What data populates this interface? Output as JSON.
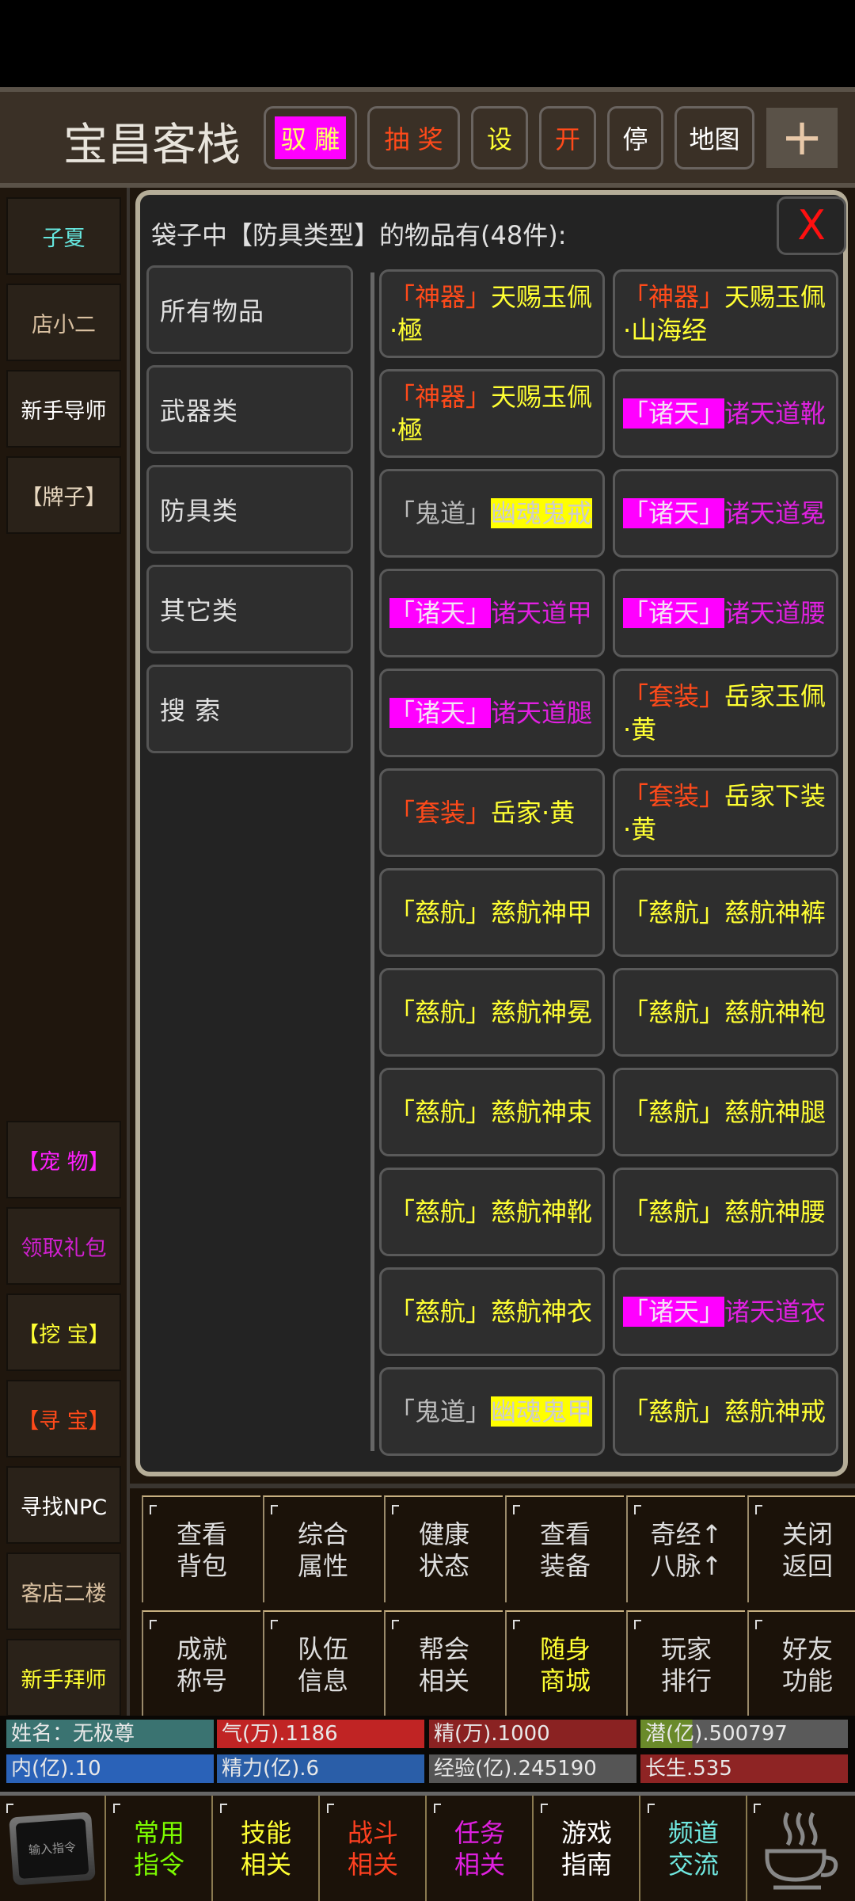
{
  "header": {
    "title": "宝昌客栈",
    "buttons": [
      {
        "label": "驭 雕",
        "color": "#ffff66",
        "bg": "#ff00ff"
      },
      {
        "label": "抽 奖",
        "color": "#ff4a1a"
      },
      {
        "label": "设",
        "color": "#ffff33"
      },
      {
        "label": "开",
        "color": "#ff4a1a"
      },
      {
        "label": "停",
        "color": "#ffffff"
      },
      {
        "label": "地图",
        "color": "#ffffff"
      }
    ],
    "plus_label": "+"
  },
  "sidebar": {
    "top": [
      {
        "label": "子夏",
        "color": "#66e8e0"
      },
      {
        "label": "店小二",
        "color": "#d9c0a0"
      },
      {
        "label": "新手导师",
        "color": "#ffffff"
      },
      {
        "label": "【牌子】",
        "color": "#e8d8c0"
      }
    ],
    "bottom": [
      {
        "label": "【宠 物】",
        "color": "#ff20ff"
      },
      {
        "label": "领取礼包",
        "color": "#d020d0"
      },
      {
        "label": "【挖 宝】",
        "color": "#ffff33"
      },
      {
        "label": "【寻 宝】",
        "color": "#ff4a1a"
      },
      {
        "label": "寻找NPC",
        "color": "#ffffff"
      },
      {
        "label": "客店二楼",
        "color": "#d9c0a0"
      },
      {
        "label": "新手拜师",
        "color": "#ffff33"
      }
    ]
  },
  "dialog": {
    "title": "袋子中【防具类型】的物品有(48件):",
    "close_label": "X",
    "categories": [
      "所有物品",
      "武器类",
      "防具类",
      "其它类",
      "搜  索"
    ],
    "items": [
      {
        "prefix": "「神器」",
        "name": "天赐玉佩·極",
        "style": "shenqi"
      },
      {
        "prefix": "「神器」",
        "name": "天赐玉佩·山海经",
        "style": "shenqi"
      },
      {
        "prefix": "「神器」",
        "name": "天赐玉佩·極",
        "style": "shenqi"
      },
      {
        "prefix": "「诸天」",
        "name": "诸天道靴",
        "style": "zhutian"
      },
      {
        "prefix": "「鬼道」",
        "name": "幽魂鬼戒",
        "style": "guidao"
      },
      {
        "prefix": "「诸天」",
        "name": "诸天道冕",
        "style": "zhutian"
      },
      {
        "prefix": "「诸天」",
        "name": "诸天道甲",
        "style": "zhutian"
      },
      {
        "prefix": "「诸天」",
        "name": "诸天道腰",
        "style": "zhutian"
      },
      {
        "prefix": "「诸天」",
        "name": "诸天道腿",
        "style": "zhutian"
      },
      {
        "prefix": "「套装」",
        "name": "岳家玉佩·黄",
        "style": "taozhuang"
      },
      {
        "prefix": "「套装」",
        "name": "岳家·黄",
        "style": "taozhuang"
      },
      {
        "prefix": "「套装」",
        "name": "岳家下装·黄",
        "style": "taozhuang"
      },
      {
        "prefix": "「慈航」",
        "name": "慈航神甲",
        "style": "cihang"
      },
      {
        "prefix": "「慈航」",
        "name": "慈航神裤",
        "style": "cihang"
      },
      {
        "prefix": "「慈航」",
        "name": "慈航神冕",
        "style": "cihang"
      },
      {
        "prefix": "「慈航」",
        "name": "慈航神袍",
        "style": "cihang"
      },
      {
        "prefix": "「慈航」",
        "name": "慈航神束",
        "style": "cihang"
      },
      {
        "prefix": "「慈航」",
        "name": "慈航神腿",
        "style": "cihang"
      },
      {
        "prefix": "「慈航」",
        "name": "慈航神靴",
        "style": "cihang"
      },
      {
        "prefix": "「慈航」",
        "name": "慈航神腰",
        "style": "cihang"
      },
      {
        "prefix": "「慈航」",
        "name": "慈航神衣",
        "style": "cihang"
      },
      {
        "prefix": "「诸天」",
        "name": "诸天道衣",
        "style": "zhutian"
      },
      {
        "prefix": "「鬼道」",
        "name": "幽魂鬼甲",
        "style": "guidao"
      },
      {
        "prefix": "「慈航」",
        "name": "慈航神戒",
        "style": "cihang"
      }
    ]
  },
  "styles": {
    "shenqi": {
      "pc": "#ff4a1a",
      "nc": "#ffff33"
    },
    "zhutian": {
      "pc": "#f4e0f4",
      "pbg": "#ff00ff",
      "nc": "#e020e0"
    },
    "guidao": {
      "pc": "#bbbbbb",
      "nc": "#cccccc",
      "nbg": "#ffff00"
    },
    "taozhuang": {
      "pc": "#ff4a1a",
      "nc": "#ffff33"
    },
    "cihang": {
      "pc": "#ffff33",
      "nc": "#ffff33"
    }
  },
  "panel": {
    "buttons": [
      [
        "查看",
        "背包"
      ],
      [
        "综合",
        "属性"
      ],
      [
        "健康",
        "状态"
      ],
      [
        "查看",
        "装备"
      ],
      [
        "奇经↑",
        "八脉↑"
      ],
      [
        "关闭",
        "返回"
      ],
      [
        "成就",
        "称号"
      ],
      [
        "队伍",
        "信息"
      ],
      [
        "帮会",
        "相关"
      ],
      [
        "随身",
        "商城"
      ],
      [
        "玩家",
        "排行"
      ],
      [
        "好友",
        "功能"
      ]
    ],
    "highlight_color": "#ffff33"
  },
  "stats": [
    {
      "label": "姓名：无极尊",
      "bg": "#3a7371"
    },
    {
      "label": "气(万).1186",
      "bg": "#c02424"
    },
    {
      "label": "精(万).1000",
      "bg": "#8a2222"
    },
    {
      "label": "潜(亿).500797",
      "bg": "#5a5a5a",
      "fill": 0.25,
      "fill_color": "#6a8a2a"
    },
    {
      "label": "内(亿).10",
      "bg": "#2a62b8"
    },
    {
      "label": "精力(亿).6",
      "bg": "#2a5ea8"
    },
    {
      "label": "经验(亿).245190",
      "bg": "#555555"
    },
    {
      "label": "长生.535",
      "bg": "#8e2424"
    }
  ],
  "nav": {
    "input_label": "输入指令",
    "buttons": [
      {
        "l1": "常用",
        "l2": "指令",
        "color": "#7cfc00"
      },
      {
        "l1": "技能",
        "l2": "相关",
        "color": "#ffff33"
      },
      {
        "l1": "战斗",
        "l2": "相关",
        "color": "#ff4020"
      },
      {
        "l1": "任务",
        "l2": "相关",
        "color": "#e020e0"
      },
      {
        "l1": "游戏",
        "l2": "指南",
        "color": "#ffffff"
      },
      {
        "l1": "频道",
        "l2": "交流",
        "color": "#70e8e0"
      }
    ]
  }
}
